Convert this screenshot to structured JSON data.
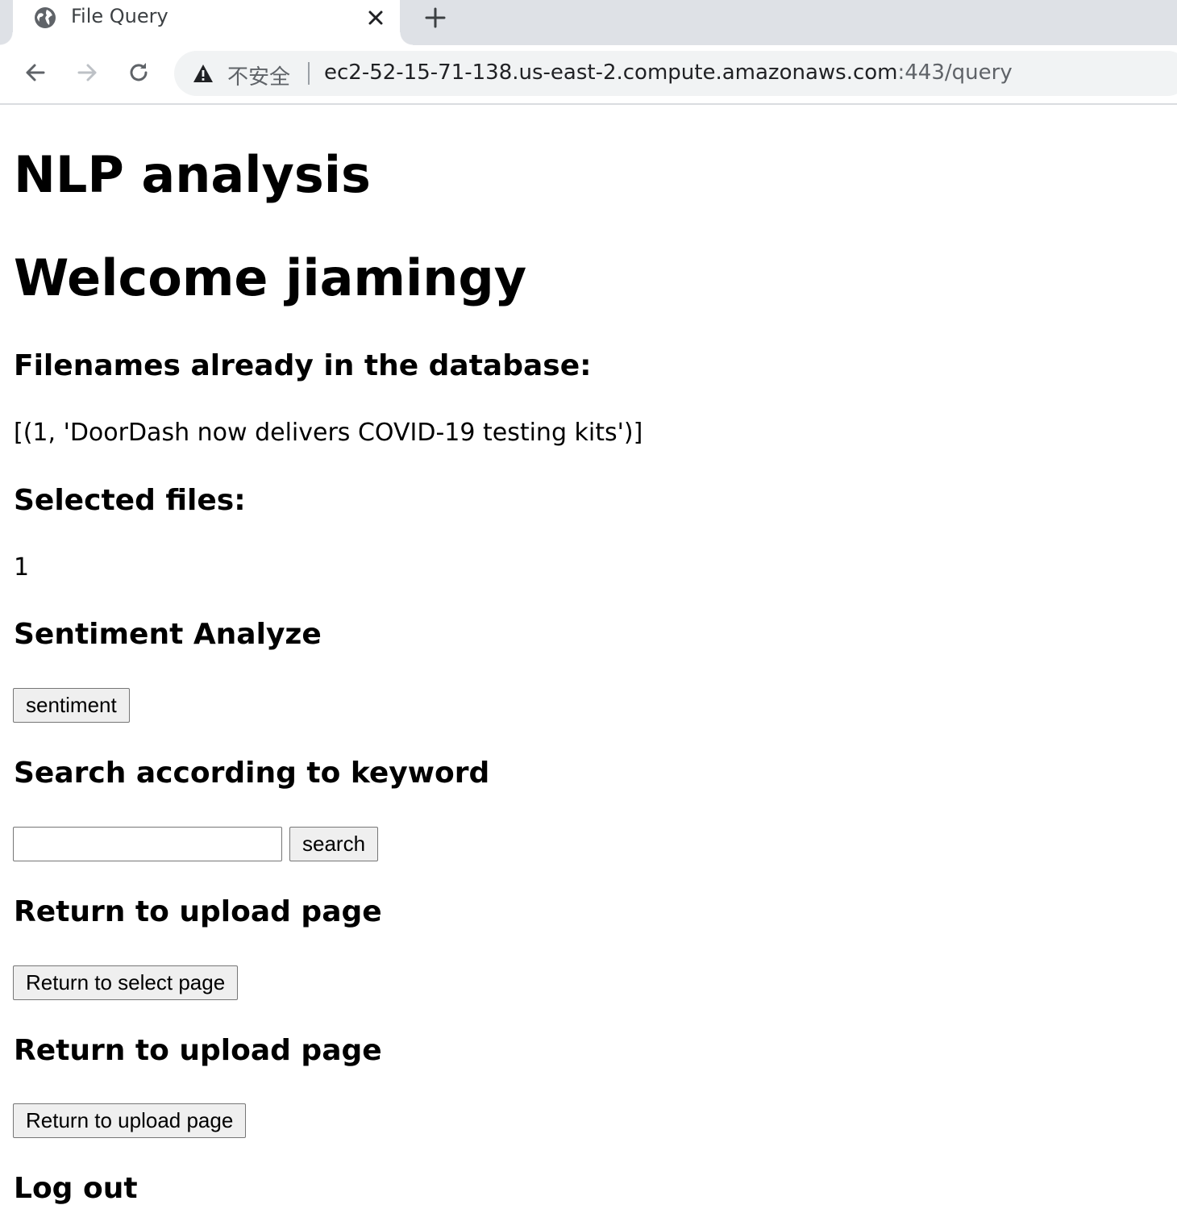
{
  "browser": {
    "tab_title": "File Query",
    "security_label": "不安全",
    "url_host": "ec2-52-15-71-138.us-east-2.compute.amazonaws.com",
    "url_rest": ":443/query"
  },
  "page": {
    "title": "NLP analysis",
    "welcome": "Welcome jiamingy",
    "filenames_heading": "Filenames already in the database:",
    "filenames_value": "[(1, 'DoorDash now delivers COVID-19 testing kits')]",
    "selected_heading": "Selected files:",
    "selected_value": "1",
    "sentiment_heading": "Sentiment Analyze",
    "sentiment_button": "sentiment",
    "search_heading": "Search according to keyword",
    "search_input_value": "",
    "search_button": "search",
    "return_select_heading": "Return to upload page",
    "return_select_button": "Return to select page",
    "return_upload_heading": "Return to upload page",
    "return_upload_button": "Return to upload page",
    "logout_heading": "Log out"
  },
  "colors": {
    "tabstrip_bg": "#dee1e6",
    "omnibox_bg": "#f1f3f4",
    "button_bg": "#efefef"
  }
}
